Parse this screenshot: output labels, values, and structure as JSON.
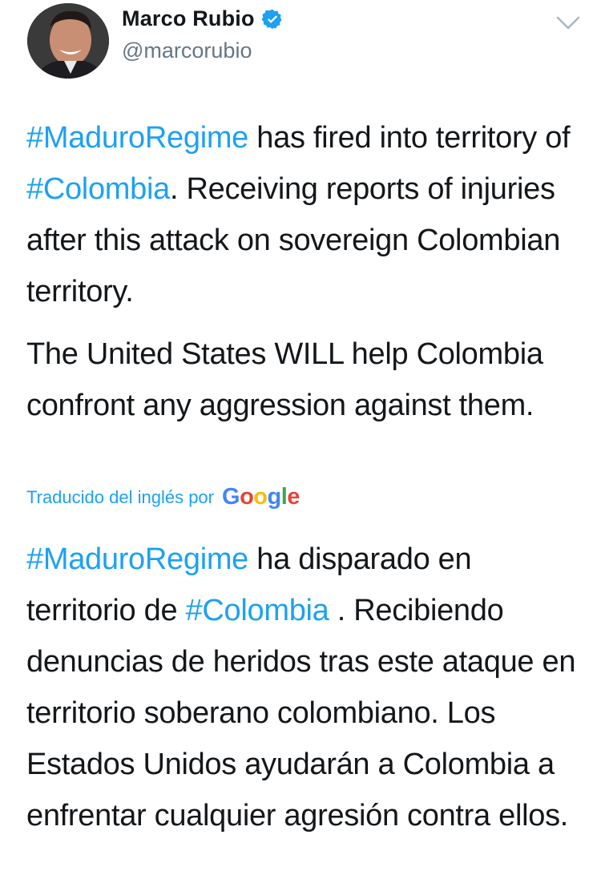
{
  "tweet": {
    "author": {
      "name": "Marco Rubio",
      "handle": "@marcorubio",
      "verified": true
    },
    "original": {
      "p1": {
        "seg1": "#MaduroRegime",
        "seg2": " has fired into territory of ",
        "seg3": "#Colombia",
        "seg4": ". Receiving reports of injuries after this attack on sovereign Colombian territory."
      },
      "p2": "The United States WILL help Colombia confront any aggression against them."
    },
    "translation": {
      "label": "Traducido del inglés por",
      "provider": "Google",
      "p": {
        "seg1": "#MaduroRegime",
        "seg2": " ha disparado en territorio de ",
        "seg3": "#Colombia",
        "seg4": " . Recibiendo denuncias de heridos tras este ataque en territorio soberano colombiano. Los Estados Unidos ayudarán a Colombia a enfrentar cualquier agresión contra ellos."
      }
    }
  },
  "colors": {
    "link": "#1da1f2",
    "text": "#14171a",
    "secondary": "#657786",
    "verified": "#1da1f2",
    "google": [
      "#4285F4",
      "#EA4335",
      "#FBBC05",
      "#4285F4",
      "#34A853",
      "#EA4335"
    ]
  },
  "icons": {
    "verified": "verified-badge-icon",
    "menu": "chevron-down-icon"
  }
}
